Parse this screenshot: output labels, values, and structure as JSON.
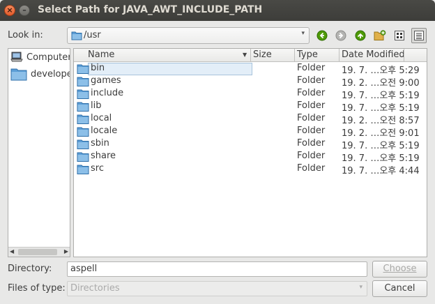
{
  "window": {
    "title": "Select Path for JAVA_AWT_INCLUDE_PATH",
    "close_glyph": "×",
    "minimize_glyph": "–"
  },
  "lookin": {
    "label": "Look in:",
    "current": "/usr",
    "arrow": "▾"
  },
  "toolbar": {
    "back_icon": "back-arrow-icon",
    "forward_icon": "forward-arrow-icon",
    "up_icon": "up-arrow-icon",
    "new_folder_icon": "new-folder-icon",
    "icon_view_icon": "icon-view-icon",
    "detail_view_icon": "detail-view-icon"
  },
  "places": {
    "items": [
      {
        "label": "Computer",
        "icon": "computer-icon"
      },
      {
        "label": "develope",
        "icon": "folder-icon"
      }
    ],
    "scroll_left": "◀",
    "scroll_right": "▶"
  },
  "table": {
    "columns": {
      "name": "Name",
      "size": "Size",
      "type": "Type",
      "date": "Date Modified"
    },
    "sort_indicator": "▼",
    "rows": [
      {
        "name": "bin",
        "size": "",
        "type": "Folder",
        "date": "19. 7. …오후 5:29"
      },
      {
        "name": "games",
        "size": "",
        "type": "Folder",
        "date": "19. 2. …오전 9:00"
      },
      {
        "name": "include",
        "size": "",
        "type": "Folder",
        "date": "19. 7. …오후 5:19"
      },
      {
        "name": "lib",
        "size": "",
        "type": "Folder",
        "date": "19. 7. …오후 5:19"
      },
      {
        "name": "local",
        "size": "",
        "type": "Folder",
        "date": "19. 2. …오전 8:57"
      },
      {
        "name": "locale",
        "size": "",
        "type": "Folder",
        "date": "19. 2. …오전 9:01"
      },
      {
        "name": "sbin",
        "size": "",
        "type": "Folder",
        "date": "19. 7. …오후 5:19"
      },
      {
        "name": "share",
        "size": "",
        "type": "Folder",
        "date": "19. 7. …오후 5:19"
      },
      {
        "name": "src",
        "size": "",
        "type": "Folder",
        "date": "19. 7. …오후 4:44"
      }
    ]
  },
  "directory": {
    "label": "Directory:",
    "value": "aspell"
  },
  "filetype": {
    "label": "Files of type:",
    "value": "Directories",
    "arrow": "▾"
  },
  "buttons": {
    "choose": "Choose",
    "cancel": "Cancel"
  },
  "colors": {
    "accent_green": "#4e9a06",
    "folder_blue": "#5c9ed6",
    "selection": "#e3eef8"
  }
}
